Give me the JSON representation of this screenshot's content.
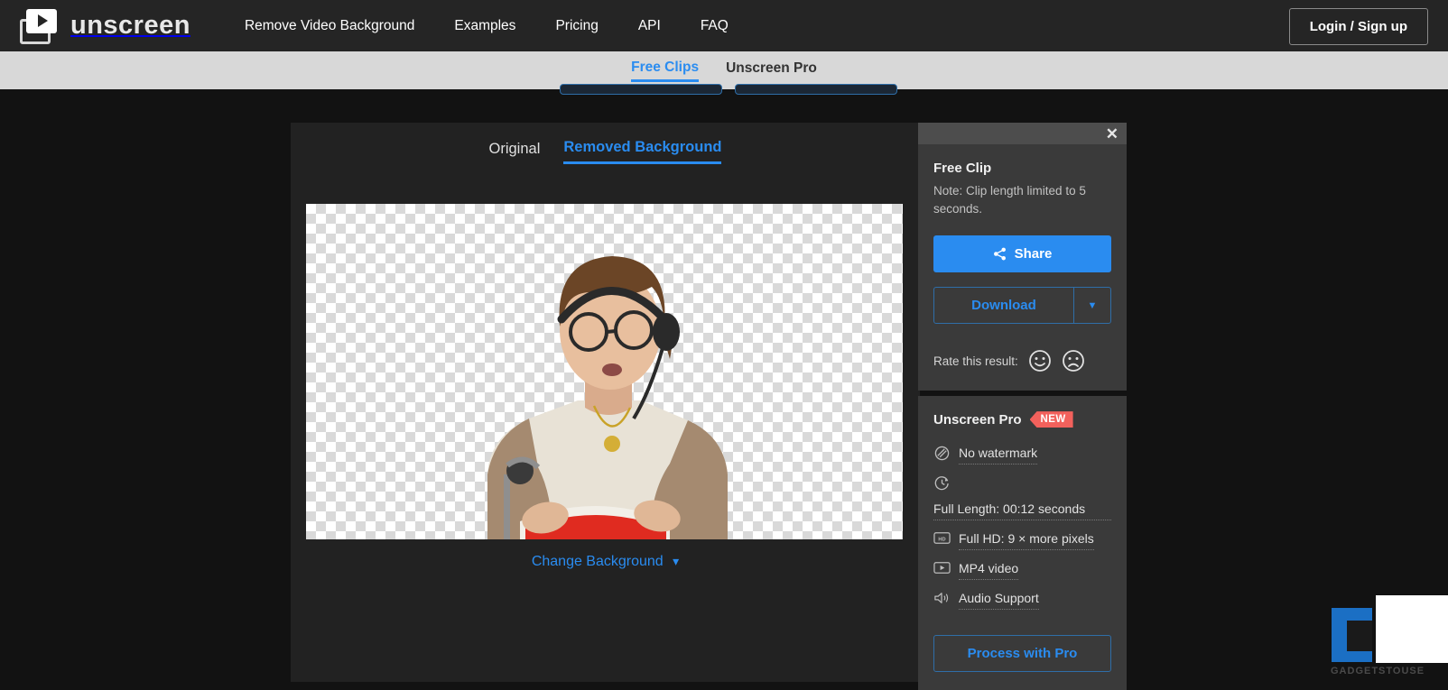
{
  "header": {
    "logo_text": "unscreen",
    "logo_icon": "play-cards-icon",
    "nav_items": [
      {
        "label": "Remove Video Background",
        "active": true
      },
      {
        "label": "Examples",
        "active": false
      },
      {
        "label": "Pricing",
        "active": false
      },
      {
        "label": "API",
        "active": false
      },
      {
        "label": "FAQ",
        "active": false
      }
    ],
    "login_label": "Login / Sign up"
  },
  "subnav": {
    "items": [
      {
        "label": "Free Clips",
        "active": true
      },
      {
        "label": "Unscreen Pro",
        "active": false
      }
    ]
  },
  "editor": {
    "tabs": [
      {
        "label": "Original",
        "active": false
      },
      {
        "label": "Removed Background",
        "active": true
      }
    ],
    "change_background_label": "Change Background",
    "change_background_icon": "chevron-down-icon"
  },
  "panel": {
    "close_icon": "close-icon",
    "free_clip": {
      "title": "Free Clip",
      "note": "Note: Clip length limited to 5 seconds.",
      "share_label": "Share",
      "share_icon": "share-icon",
      "download_label": "Download",
      "download_dropdown_icon": "caret-down-icon",
      "rate_label": "Rate this result:",
      "rate_positive_icon": "smiley-face-icon",
      "rate_negative_icon": "frowny-face-icon"
    },
    "pro": {
      "title": "Unscreen Pro",
      "badge": "NEW",
      "features": [
        {
          "label": "No watermark",
          "icon": "no-watermark-icon",
          "wrapped": false
        },
        {
          "label": "Full Length: 00:12 seconds",
          "icon": "clock-icon",
          "wrapped": true
        },
        {
          "label": "Full HD: 9 × more pixels",
          "icon": "hd-icon",
          "wrapped": false
        },
        {
          "label": "MP4 video",
          "icon": "video-file-icon",
          "wrapped": false
        },
        {
          "label": "Audio Support",
          "icon": "speaker-icon",
          "wrapped": false
        }
      ],
      "cta_label": "Process with Pro"
    }
  },
  "watermark": {
    "text": "GADGETSTOUSE"
  },
  "colors": {
    "accent_blue": "#2a8cf0",
    "badge_red": "#f2615c",
    "nav_bg": "#252525",
    "subnav_bg": "#d8d8d8",
    "page_bg": "#121212",
    "panel_bg": "#3a3a3a",
    "card_bg": "#222222"
  }
}
